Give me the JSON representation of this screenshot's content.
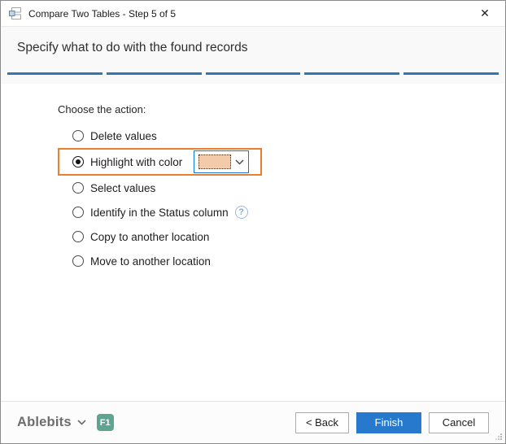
{
  "window": {
    "title": "Compare Two Tables - Step 5 of 5",
    "close_glyph": "✕"
  },
  "header": {
    "heading": "Specify what to do with the found records",
    "progress": {
      "total_steps": 5,
      "current_step": 5
    }
  },
  "main": {
    "prompt": "Choose the action:",
    "options": [
      {
        "label": "Delete values",
        "selected": false
      },
      {
        "label": "Highlight with color",
        "selected": true,
        "annotated": true,
        "has_color_picker": true
      },
      {
        "label": "Select values",
        "selected": false
      },
      {
        "label": "Identify in the Status column",
        "selected": false,
        "has_help": true
      },
      {
        "label": "Copy to another location",
        "selected": false
      },
      {
        "label": "Move to another location",
        "selected": false
      }
    ],
    "help_glyph": "?",
    "color_picker": {
      "swatch_color": "#f4cbaa"
    }
  },
  "footer": {
    "brand": "Ablebits",
    "f1_badge": "F1",
    "buttons": {
      "back": "< Back",
      "finish": "Finish",
      "cancel": "Cancel"
    }
  },
  "colors": {
    "progress_segment": "#3176b5",
    "finish_button": "#2679cd",
    "annotation_orange": "#e87e2e",
    "combo_border": "#1179d2",
    "f1_badge": "#5fa391",
    "help_icon": "#82a8da"
  }
}
